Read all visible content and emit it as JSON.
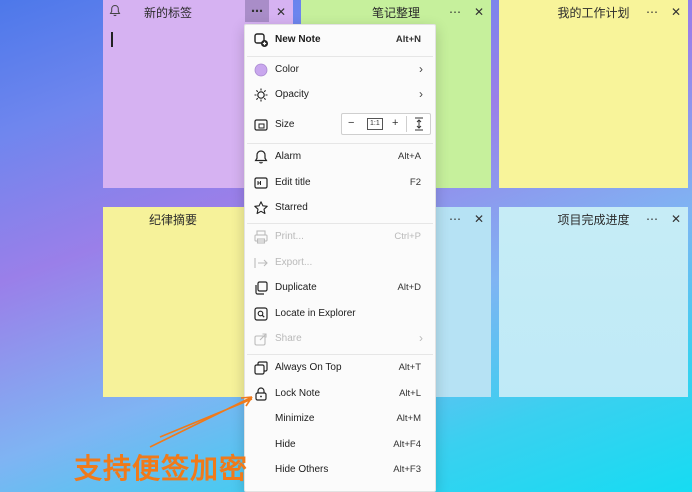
{
  "notes": [
    {
      "title": "新的标签",
      "color": "#d6b2f2"
    },
    {
      "title": "笔记整理",
      "color": "#c6f09c"
    },
    {
      "title": "我的工作计划",
      "color": "#f8f49a"
    },
    {
      "title": "纪律摘要",
      "color": "#f6f29a"
    },
    {
      "title": "",
      "color": "#b6e2f4"
    },
    {
      "title": "项目完成进度",
      "color": "#bfeaf6"
    }
  ],
  "header_icons": {
    "more": "⋯",
    "close": "✕",
    "bell": "bell-icon"
  },
  "menu": {
    "new_note": {
      "label": "New Note",
      "shortcut": "Alt+N"
    },
    "color": {
      "label": "Color"
    },
    "opacity": {
      "label": "Opacity"
    },
    "size": {
      "label": "Size",
      "minus": "−",
      "one_to_one": "1:1",
      "plus": "+"
    },
    "alarm": {
      "label": "Alarm",
      "shortcut": "Alt+A"
    },
    "edit_title": {
      "label": "Edit title",
      "shortcut": "F2"
    },
    "starred": {
      "label": "Starred"
    },
    "print": {
      "label": "Print...",
      "shortcut": "Ctrl+P"
    },
    "export": {
      "label": "Export..."
    },
    "duplicate": {
      "label": "Duplicate",
      "shortcut": "Alt+D"
    },
    "locate": {
      "label": "Locate in Explorer"
    },
    "share": {
      "label": "Share"
    },
    "always_on_top": {
      "label": "Always On Top",
      "shortcut": "Alt+T"
    },
    "lock_note": {
      "label": "Lock Note",
      "shortcut": "Alt+L"
    },
    "minimize": {
      "label": "Minimize",
      "shortcut": "Alt+M"
    },
    "hide": {
      "label": "Hide",
      "shortcut": "Alt+F4"
    },
    "hide_others": {
      "label": "Hide Others",
      "shortcut": "Alt+F3"
    }
  },
  "annotation": {
    "text": "支持便签加密",
    "color": "#f07a1a"
  }
}
